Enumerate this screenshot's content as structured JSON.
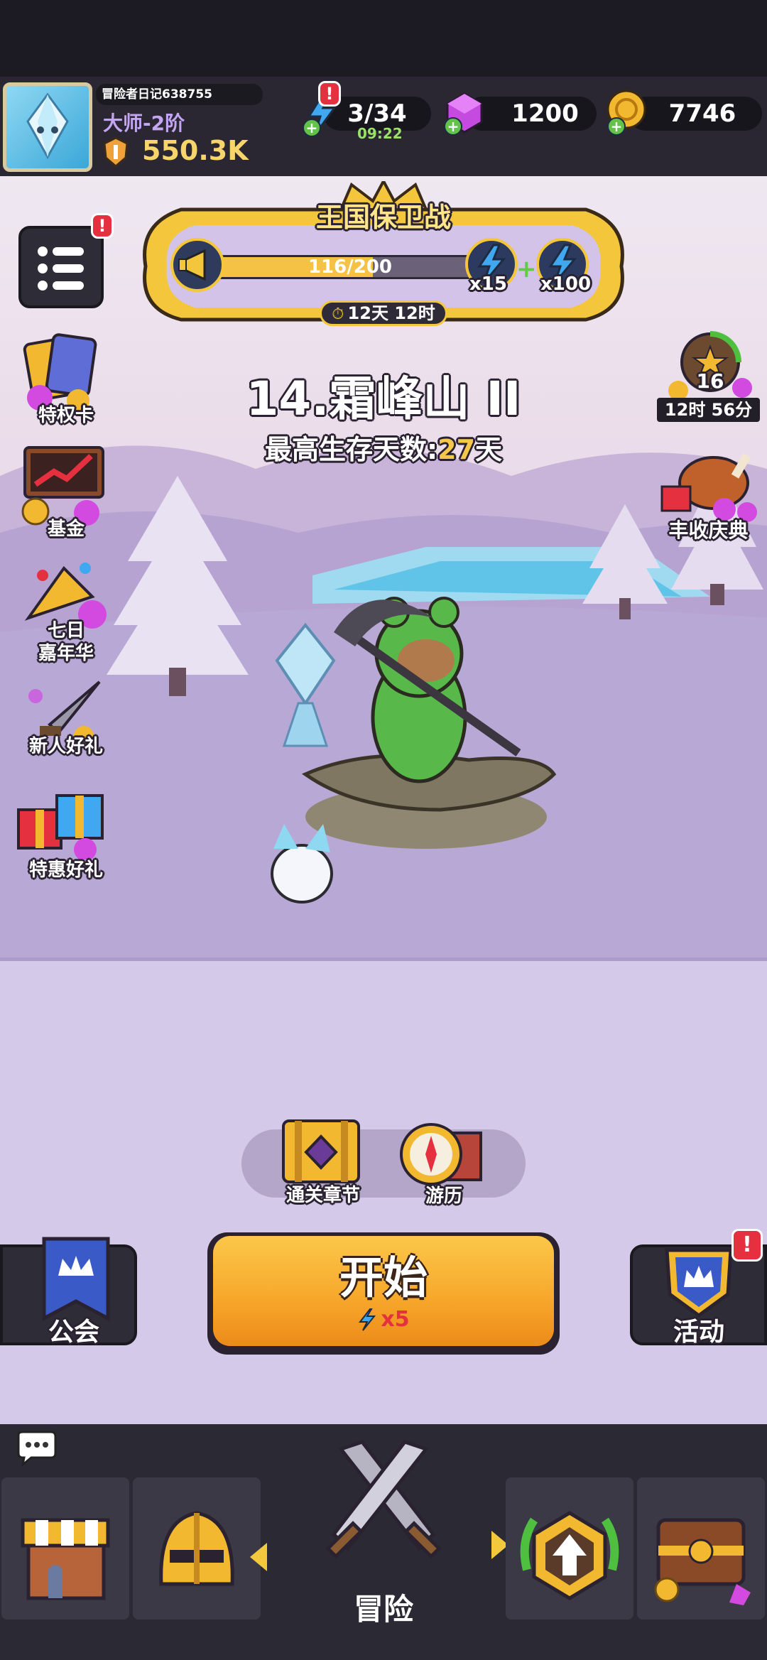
{
  "player": {
    "name": "冒险者日记638755",
    "rank": "大师-2阶",
    "power": "550.3K"
  },
  "resources": {
    "energy": "3/34",
    "energy_timer": "09:22",
    "gems": "1200",
    "gold": "7746"
  },
  "event_banner": {
    "title": "王国保卫战",
    "progress_text": "116/200",
    "progress_value": 0.58,
    "reward_1": "x15",
    "reward_2": "x100",
    "timer": "12天 12时"
  },
  "stage": {
    "title": "14.霜峰山 II",
    "record_label": "最高生存天数:",
    "record_value": "27",
    "record_unit": "天"
  },
  "left_menu": [
    {
      "label": "特权卡",
      "icon": "privilege-card-icon"
    },
    {
      "label": "基金",
      "icon": "fund-icon"
    },
    {
      "label": "七日\n嘉年华",
      "icon": "seven-day-carnival-icon"
    },
    {
      "label": "新人好礼",
      "icon": "newbie-gift-icon"
    },
    {
      "label": "特惠好礼",
      "icon": "special-gift-icon"
    }
  ],
  "right_menu": {
    "level_reward": {
      "level": "16",
      "timer": "12时 56分"
    },
    "harvest": {
      "label": "丰收庆典"
    }
  },
  "mini_buttons": {
    "chapters": "通关章节",
    "travel": "游历"
  },
  "start": {
    "label": "开始",
    "cost": "x5"
  },
  "guild": {
    "label": "公会"
  },
  "activity": {
    "label": "活动"
  },
  "nav": {
    "center_label": "冒险"
  },
  "colors": {
    "accent_orange": "#f5a72c",
    "badge_red": "#e5303f",
    "topbar": "#2a2733",
    "scene_snow": "#c7b6db"
  }
}
